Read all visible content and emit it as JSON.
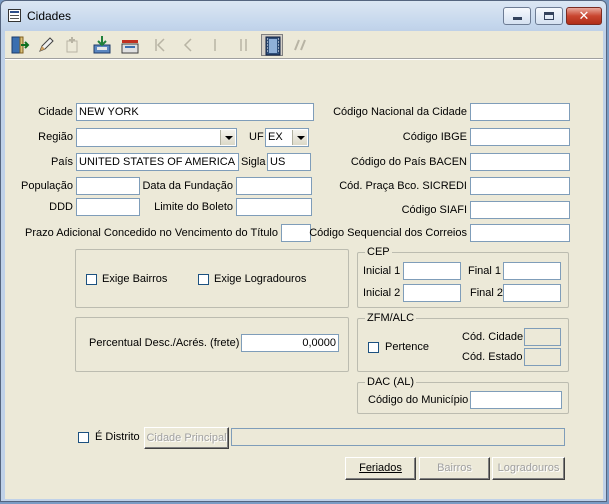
{
  "window": {
    "title": "Cidades"
  },
  "toolbar": {
    "buttons": [
      {
        "name": "exit-icon",
        "enabled": true
      },
      {
        "name": "edit-icon",
        "enabled": true
      },
      {
        "name": "new-record-icon",
        "enabled": false
      },
      {
        "name": "save-icon",
        "enabled": true
      },
      {
        "name": "cancel-icon",
        "enabled": true
      },
      {
        "name": "first-record-icon",
        "enabled": false
      },
      {
        "name": "previous-record-icon",
        "enabled": false
      },
      {
        "name": "next-record-icon",
        "enabled": false
      },
      {
        "name": "last-record-icon",
        "enabled": false
      },
      {
        "name": "film-icon",
        "enabled": true
      },
      {
        "name": "search-icon",
        "enabled": false
      }
    ]
  },
  "form": {
    "cidade": {
      "label": "Cidade",
      "value": "NEW YORK"
    },
    "regiao": {
      "label": "Região",
      "value": ""
    },
    "uf": {
      "label": "UF",
      "value": "EX"
    },
    "pais": {
      "label": "País",
      "value": "UNITED STATES OF AMERICA"
    },
    "sigla": {
      "label": "Sigla",
      "value": "US"
    },
    "populacao": {
      "label": "População",
      "value": ""
    },
    "data_fundacao": {
      "label": "Data da Fundação",
      "value": ""
    },
    "ddd": {
      "label": "DDD",
      "value": ""
    },
    "limite_boleto": {
      "label": "Limite do Boleto",
      "value": ""
    },
    "prazo_adicional": {
      "label": "Prazo Adicional Concedido no Vencimento do Título",
      "value": ""
    },
    "codigo_nacional": {
      "label": "Código Nacional da Cidade",
      "value": ""
    },
    "codigo_ibge": {
      "label": "Código IBGE",
      "value": ""
    },
    "codigo_pais_bacen": {
      "label": "Código do País BACEN",
      "value": ""
    },
    "cod_praca_sicredi": {
      "label": "Cód. Praça Bco. SICREDI",
      "value": ""
    },
    "codigo_siafi": {
      "label": "Código SIAFI",
      "value": ""
    },
    "codigo_sequencial_correios": {
      "label": "Código Sequencial dos Correios",
      "value": ""
    },
    "exige_bairros": {
      "label": "Exige Bairros",
      "checked": false
    },
    "exige_logradouros": {
      "label": "Exige Logradouros",
      "checked": false
    },
    "percentual": {
      "label": "Percentual Desc./Acrés. (frete)",
      "value": "0,0000"
    },
    "cep": {
      "title": "CEP",
      "inicial1_label": "Inicial 1",
      "inicial1": "",
      "final1_label": "Final 1",
      "final1": "",
      "inicial2_label": "Inicial 2",
      "inicial2": "",
      "final2_label": "Final 2",
      "final2": ""
    },
    "zfm": {
      "title": "ZFM/ALC",
      "pertence_label": "Pertence",
      "pertence": false,
      "cod_cidade_label": "Cód. Cidade",
      "cod_cidade": "",
      "cod_estado_label": "Cód. Estado",
      "cod_estado": ""
    },
    "dac": {
      "title": "DAC (AL)",
      "codigo_municipio_label": "Código do Município",
      "codigo_municipio": ""
    },
    "e_distrito": {
      "label": "É Distrito",
      "checked": false
    },
    "cidade_principal": {
      "label": "Cidade Principal",
      "value": ""
    }
  },
  "buttons": {
    "feriados": "Feriados",
    "bairros": "Bairros",
    "logradouros": "Logradouros"
  }
}
